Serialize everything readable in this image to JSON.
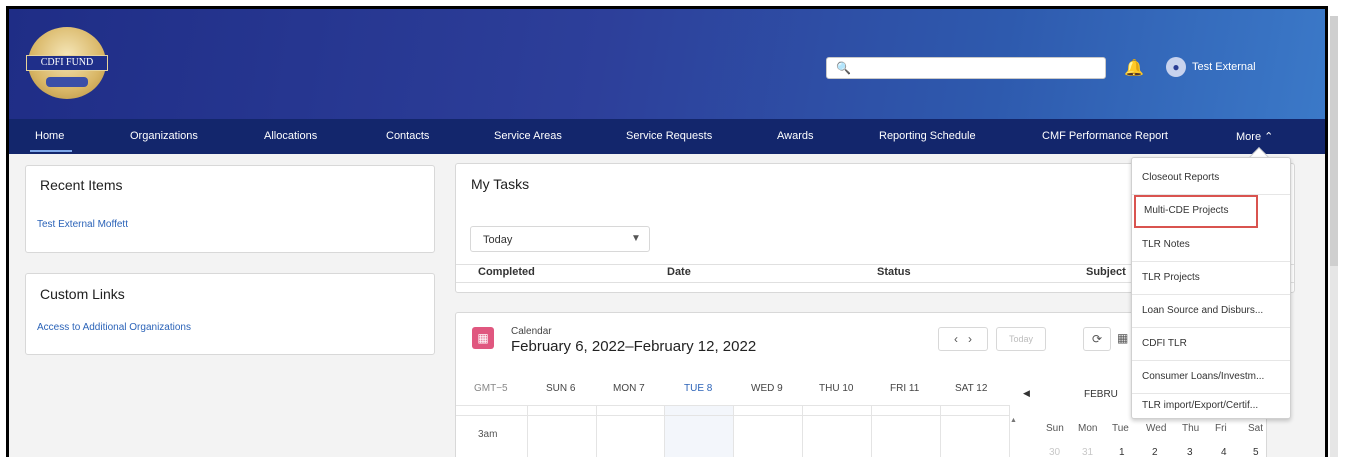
{
  "header": {
    "logo_text": "CDFI FUND",
    "search": {
      "placeholder": ""
    },
    "user_name": "Test External",
    "colors": {
      "header_dark": "#1f2d86",
      "header_light": "#3b79c8",
      "nav": "#13266c"
    }
  },
  "nav": {
    "items": [
      "Home",
      "Organizations",
      "Allocations",
      "Contacts",
      "Service Areas",
      "Service Requests",
      "Awards",
      "Reporting Schedule",
      "CMF Performance Report",
      "More"
    ],
    "active": "Home"
  },
  "more_menu": {
    "items": [
      "Closeout Reports",
      "Multi-CDE Projects",
      "TLR Notes",
      "TLR Projects",
      "Loan Source and Disburs...",
      "CDFI TLR",
      "Consumer Loans/Investm...",
      "TLR import/Export/Certif..."
    ],
    "highlighted": "Multi-CDE Projects"
  },
  "recent_items": {
    "title": "Recent Items",
    "links": [
      "Test External Moffett"
    ]
  },
  "custom_links": {
    "title": "Custom Links",
    "links": [
      "Access to Additional Organizations"
    ]
  },
  "my_tasks": {
    "title": "My Tasks",
    "filter_value": "Today",
    "columns": [
      "Completed",
      "Date",
      "Status",
      "Subject"
    ]
  },
  "calendar": {
    "label": "Calendar",
    "range": "February 6, 2022–February 12, 2022",
    "today_button": "Today",
    "timezone": "GMT−5",
    "days": [
      "SUN 6",
      "MON 7",
      "TUE 8",
      "WED 9",
      "THU 10",
      "FRI 11",
      "SAT 12"
    ],
    "today_day": "TUE 8",
    "hours": [
      "3am"
    ],
    "mini_calendar": {
      "month": "FEBRU",
      "weekdays": [
        "Sun",
        "Mon",
        "Tue",
        "Wed",
        "Thu",
        "Fri",
        "Sat"
      ],
      "first_row": [
        "30",
        "31",
        "1",
        "2",
        "3",
        "4",
        "5"
      ]
    }
  }
}
